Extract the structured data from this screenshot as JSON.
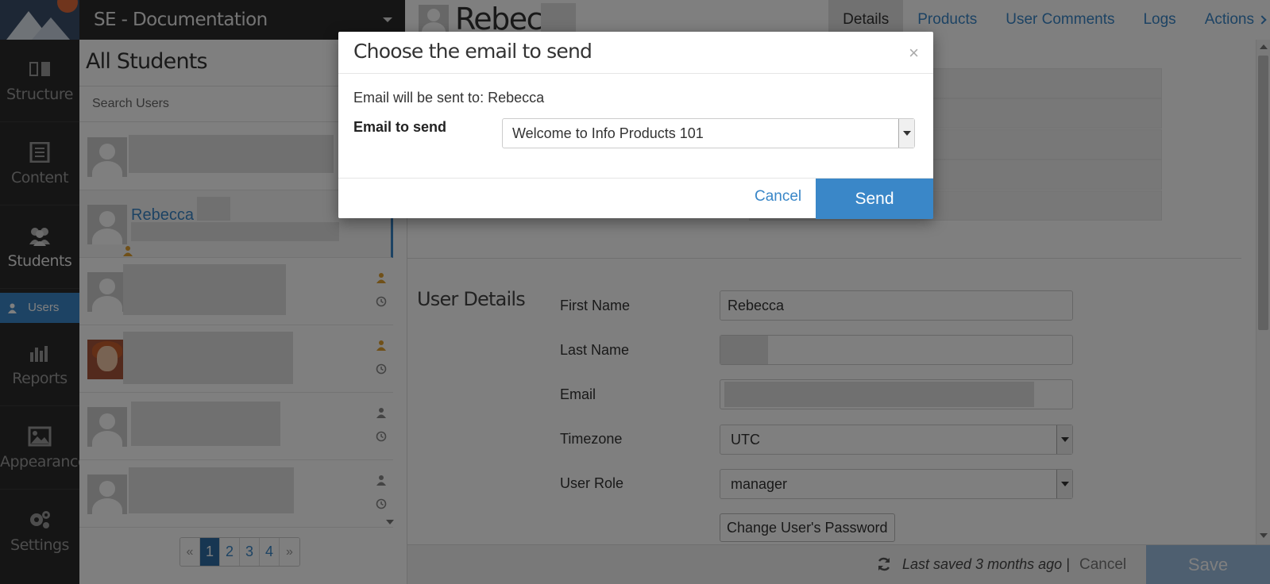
{
  "app": {
    "workspace_title": "SE - Documentation"
  },
  "nav": {
    "items": [
      {
        "label": "Structure",
        "icon": "structure-icon"
      },
      {
        "label": "Content",
        "icon": "content-icon"
      },
      {
        "label": "Students",
        "icon": "students-icon"
      },
      {
        "label": "Reports",
        "icon": "reports-icon"
      },
      {
        "label": "Appearance",
        "icon": "appearance-icon"
      },
      {
        "label": "Settings",
        "icon": "gear-icon"
      }
    ],
    "sub_item": {
      "label": "Users",
      "icon": "user-icon"
    }
  },
  "list": {
    "heading": "All Students",
    "search_placeholder": "Search Users",
    "selected_name": "Rebecca",
    "pagination": {
      "prev": "«",
      "pages": [
        "1",
        "2",
        "3",
        "4"
      ],
      "next": "»",
      "current": "1"
    }
  },
  "user": {
    "name": "Rebecca",
    "tabs": [
      "Details",
      "Products",
      "User Comments",
      "Logs",
      "Actions"
    ],
    "active_tab": "Details",
    "section_title": "User Details",
    "fields": {
      "first_name_label": "First Name",
      "first_name_value": "Rebecca",
      "last_name_label": "Last Name",
      "email_label": "Email",
      "timezone_label": "Timezone",
      "timezone_value": "UTC",
      "role_label": "User Role",
      "role_value": "manager"
    },
    "change_password_label": "Change User's Password"
  },
  "footer": {
    "last_saved": "Last saved 3 months ago |",
    "cancel_label": "Cancel",
    "save_label": "Save"
  },
  "modal": {
    "title": "Choose the email to send",
    "close": "×",
    "info": "Email will be sent to: Rebecca",
    "select_label": "Email to send",
    "select_value": "Welcome to Info Products 101",
    "cancel_label": "Cancel",
    "send_label": "Send"
  },
  "colors": {
    "accent": "#3a87c8",
    "nav_bg": "#2b2b2b",
    "pagination_active": "#2e6da4"
  }
}
